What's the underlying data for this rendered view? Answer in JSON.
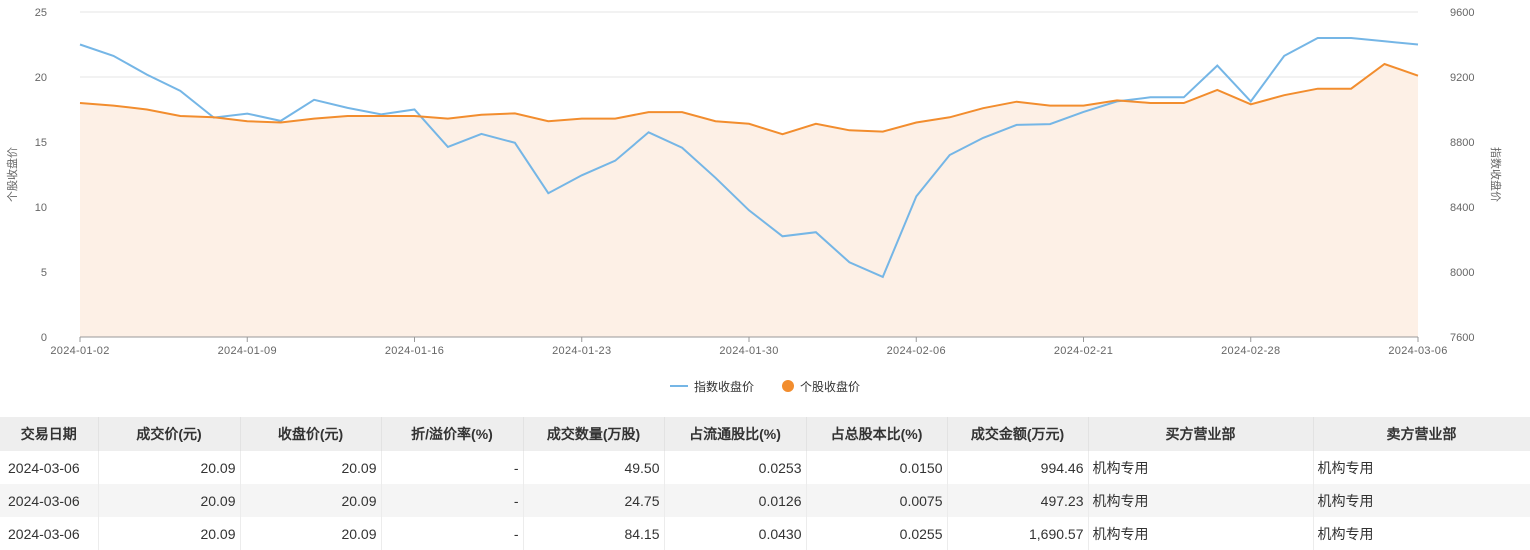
{
  "colors": {
    "index": "#75b6e6",
    "stock": "#f28d2e",
    "fill": "#fdf0e6",
    "grid": "#e6e6e6"
  },
  "chart_data": {
    "type": "line",
    "x_dates": [
      "2024-01-02",
      "2024-01-03",
      "2024-01-04",
      "2024-01-05",
      "2024-01-08",
      "2024-01-09",
      "2024-01-10",
      "2024-01-11",
      "2024-01-12",
      "2024-01-15",
      "2024-01-16",
      "2024-01-17",
      "2024-01-18",
      "2024-01-19",
      "2024-01-22",
      "2024-01-23",
      "2024-01-24",
      "2024-01-25",
      "2024-01-26",
      "2024-01-29",
      "2024-01-30",
      "2024-01-31",
      "2024-02-01",
      "2024-02-02",
      "2024-02-05",
      "2024-02-06",
      "2024-02-07",
      "2024-02-08",
      "2024-02-19",
      "2024-02-20",
      "2024-02-21",
      "2024-02-22",
      "2024-02-23",
      "2024-02-26",
      "2024-02-27",
      "2024-02-28",
      "2024-02-29",
      "2024-03-01",
      "2024-03-04",
      "2024-03-05",
      "2024-03-06"
    ],
    "x_ticks": [
      "2024-01-02",
      "2024-01-09",
      "2024-01-16",
      "2024-01-23",
      "2024-01-30",
      "2024-02-06",
      "2024-02-21",
      "2024-02-28",
      "2024-03-06"
    ],
    "left_axis": {
      "label": "个股收盘价",
      "ticks": [
        "0",
        "5",
        "10",
        "15",
        "20",
        "25"
      ],
      "min": 0,
      "max": 25
    },
    "right_axis": {
      "label": "指数收盘价",
      "ticks": [
        "7600",
        "8000",
        "8400",
        "8800",
        "9200",
        "9600"
      ],
      "min": 7600,
      "max": 9600
    },
    "series": [
      {
        "name": "指数收盘价",
        "axis": "right",
        "style": "line",
        "values": [
          9400,
          9330,
          9215,
          9115,
          8950,
          8975,
          8930,
          9060,
          9010,
          8970,
          9000,
          8770,
          8850,
          8795,
          8485,
          8595,
          8685,
          8860,
          8765,
          8580,
          8380,
          8220,
          8245,
          8060,
          7970,
          8465,
          8720,
          8825,
          8905,
          8910,
          8985,
          9050,
          9075,
          9075,
          9270,
          9050,
          9330,
          9440,
          9440,
          9420,
          9400
        ]
      },
      {
        "name": "个股收盘价",
        "axis": "left",
        "style": "area-line",
        "values": [
          18.0,
          17.8,
          17.5,
          17.0,
          16.9,
          16.6,
          16.5,
          16.8,
          17.0,
          17.0,
          17.0,
          16.8,
          17.1,
          17.2,
          16.6,
          16.8,
          16.8,
          17.3,
          17.3,
          16.6,
          16.4,
          15.6,
          16.4,
          15.9,
          15.8,
          16.5,
          16.9,
          17.6,
          18.1,
          17.8,
          17.8,
          18.2,
          18.0,
          18.0,
          19.0,
          17.9,
          18.6,
          19.1,
          19.1,
          21.0,
          20.1
        ]
      }
    ],
    "legend": [
      "指数收盘价",
      "个股收盘价"
    ],
    "legend_position": "bottom-center",
    "grid": true
  },
  "table": {
    "headers": [
      "交易日期",
      "成交价(元)",
      "收盘价(元)",
      "折/溢价率(%)",
      "成交数量(万股)",
      "占流通股比(%)",
      "占总股本比(%)",
      "成交金额(万元)",
      "买方营业部",
      "卖方营业部"
    ],
    "rows": [
      {
        "date": "2024-03-06",
        "price": "20.09",
        "close": "20.09",
        "premium": "-",
        "volume": "49.50",
        "float_ratio": "0.0253",
        "total_ratio": "0.0150",
        "amount": "994.46",
        "buyer": "机构专用",
        "seller": "机构专用"
      },
      {
        "date": "2024-03-06",
        "price": "20.09",
        "close": "20.09",
        "premium": "-",
        "volume": "24.75",
        "float_ratio": "0.0126",
        "total_ratio": "0.0075",
        "amount": "497.23",
        "buyer": "机构专用",
        "seller": "机构专用"
      },
      {
        "date": "2024-03-06",
        "price": "20.09",
        "close": "20.09",
        "premium": "-",
        "volume": "84.15",
        "float_ratio": "0.0430",
        "total_ratio": "0.0255",
        "amount": "1,690.57",
        "buyer": "机构专用",
        "seller": "机构专用"
      }
    ]
  }
}
